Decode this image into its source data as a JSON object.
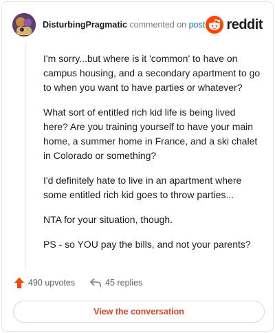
{
  "header": {
    "author": "DisturbingPragmatic",
    "verb": "commented on",
    "target_link": "post",
    "brand": "reddit"
  },
  "comment": {
    "paragraphs": [
      "I'm sorry...but where is it 'common' to have on campus housing, and a secondary apartment to go to when you want to have parties or whatever?",
      "What sort of entitled rich kid life is being lived here? Are you training yourself to have your main home, a summer home in France, and a ski chalet in Colorado or something?",
      "I'd definitely hate to live in an apartment where some entitled rich kid goes to throw parties...",
      "NTA for your situation, though.",
      "PS - so YOU pay the bills, and not your parents?"
    ]
  },
  "stats": {
    "upvotes": "490 upvotes",
    "replies": "45 replies"
  },
  "cta": {
    "label": "View the conversation"
  },
  "colors": {
    "accent": "#ff4500",
    "link": "#0079d3",
    "cta_text": "#e0442a"
  },
  "icons": [
    "avatar",
    "reddit-snoo-icon",
    "upvote-arrow-icon",
    "reply-arrow-icon"
  ]
}
